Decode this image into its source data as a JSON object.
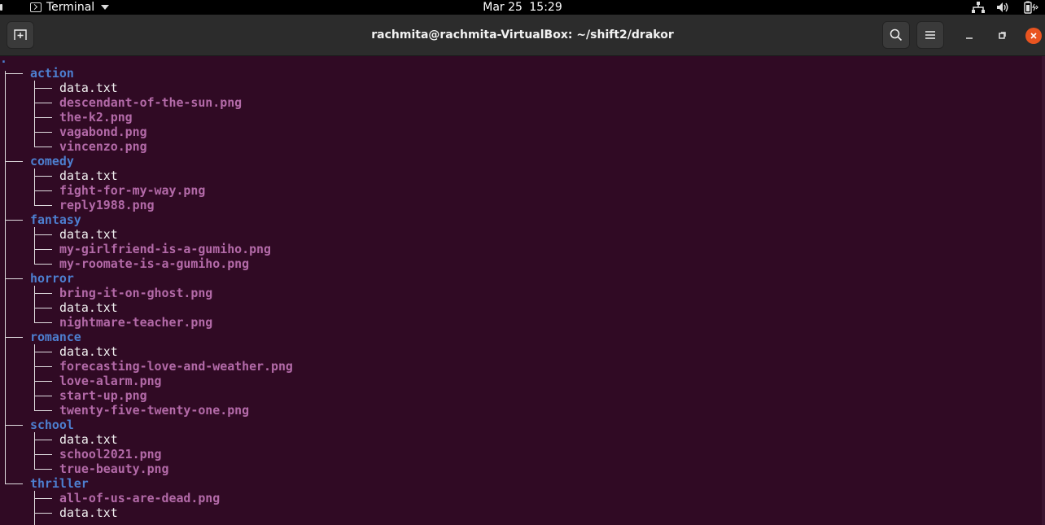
{
  "topbar": {
    "app_name": "Terminal",
    "date": "Mar 25",
    "time": "15:29",
    "icons": [
      "network-icon",
      "volume-icon",
      "battery-icon"
    ]
  },
  "window": {
    "title": "rachmita@rachmita-VirtualBox: ~/shift2/drakor",
    "buttons": [
      "new-tab-icon",
      "search-icon",
      "menu-icon",
      "minimize-icon",
      "maximize-icon",
      "close-icon"
    ]
  },
  "terminal": {
    "root": ".",
    "directories": [
      {
        "name": "action",
        "entries": [
          {
            "name": "data.txt",
            "kind": "file"
          },
          {
            "name": "descendant-of-the-sun.png",
            "kind": "img"
          },
          {
            "name": "the-k2.png",
            "kind": "img"
          },
          {
            "name": "vagabond.png",
            "kind": "img"
          },
          {
            "name": "vincenzo.png",
            "kind": "img"
          }
        ]
      },
      {
        "name": "comedy",
        "entries": [
          {
            "name": "data.txt",
            "kind": "file"
          },
          {
            "name": "fight-for-my-way.png",
            "kind": "img"
          },
          {
            "name": "reply1988.png",
            "kind": "img"
          }
        ]
      },
      {
        "name": "fantasy",
        "entries": [
          {
            "name": "data.txt",
            "kind": "file"
          },
          {
            "name": "my-girlfriend-is-a-gumiho.png",
            "kind": "img"
          },
          {
            "name": "my-roomate-is-a-gumiho.png",
            "kind": "img"
          }
        ]
      },
      {
        "name": "horror",
        "entries": [
          {
            "name": "bring-it-on-ghost.png",
            "kind": "img"
          },
          {
            "name": "data.txt",
            "kind": "file"
          },
          {
            "name": "nightmare-teacher.png",
            "kind": "img"
          }
        ]
      },
      {
        "name": "romance",
        "entries": [
          {
            "name": "data.txt",
            "kind": "file"
          },
          {
            "name": "forecasting-love-and-weather.png",
            "kind": "img"
          },
          {
            "name": "love-alarm.png",
            "kind": "img"
          },
          {
            "name": "start-up.png",
            "kind": "img"
          },
          {
            "name": "twenty-five-twenty-one.png",
            "kind": "img"
          }
        ]
      },
      {
        "name": "school",
        "entries": [
          {
            "name": "data.txt",
            "kind": "file"
          },
          {
            "name": "school2021.png",
            "kind": "img"
          },
          {
            "name": "true-beauty.png",
            "kind": "img"
          }
        ]
      },
      {
        "name": "thriller",
        "entries": [
          {
            "name": "all-of-us-are-dead.png",
            "kind": "img"
          },
          {
            "name": "data.txt",
            "kind": "file"
          }
        ]
      }
    ]
  },
  "colors": {
    "terminal_bg": "#300a24",
    "directory": "#4d7fd0",
    "image_file": "#b36aa8",
    "plain_file": "#f2f2f2",
    "close_button": "#e95420"
  }
}
